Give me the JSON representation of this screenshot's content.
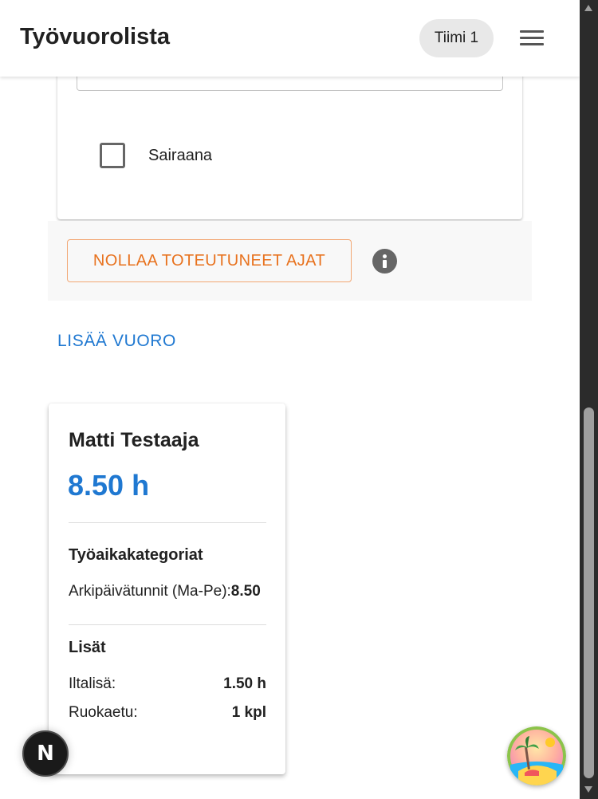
{
  "header": {
    "title": "Työvuorolista",
    "team_label": "Tiimi 1"
  },
  "form": {
    "sick_label": "Sairaana"
  },
  "actions": {
    "reset_label": "NOLLAA TOTEUTUNEET AJAT",
    "add_shift_label": "LISÄÄ VUORO"
  },
  "summary": {
    "employee_name": "Matti Testaaja",
    "total_hours": "8.50 h",
    "categories_heading": "Työaikakategoriat",
    "weekday_label": "Arkipäivätunnit (Ma-Pe):",
    "weekday_value": "8.50",
    "extras_heading": "Lisät",
    "evening_label": "Iltalisä:",
    "evening_value": "1.50 h",
    "meal_label": "Ruokaetu:",
    "meal_value": "1 kpl"
  },
  "floating": {
    "next_badge_letter": "N"
  },
  "colors": {
    "accent_blue": "#1f78d1",
    "accent_orange": "#e8721e"
  }
}
